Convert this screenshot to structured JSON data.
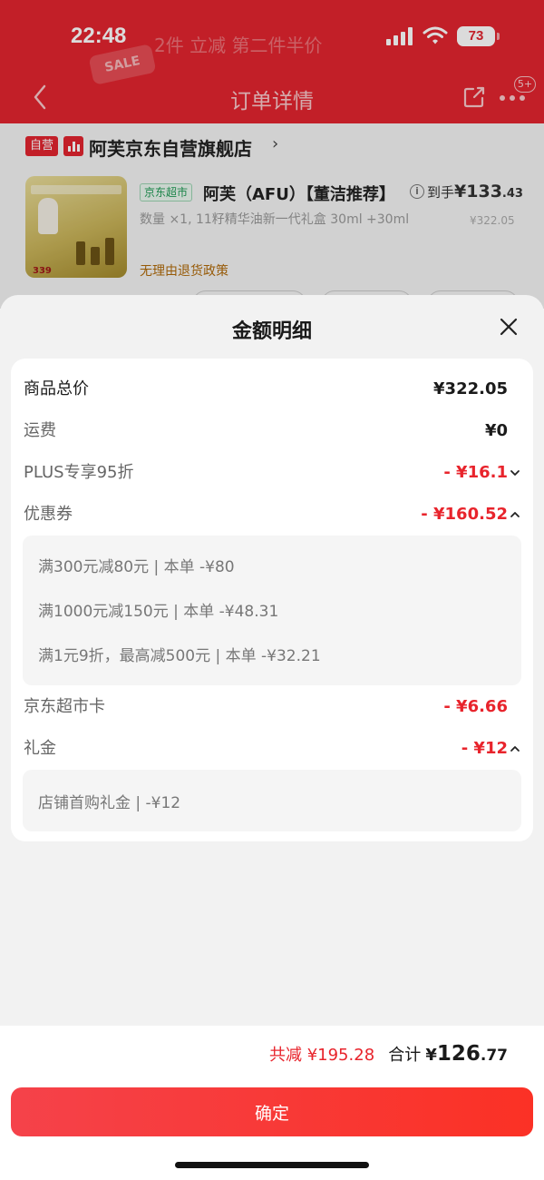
{
  "status_bar": {
    "time": "22:48",
    "battery": "73"
  },
  "background": {
    "deco_text": "2件 立减 第二件半价",
    "deco_badge": "SALE",
    "nav": {
      "title": "订单详情",
      "badge": "5+"
    },
    "store": {
      "tag": "自营",
      "name": "阿芙京东自营旗舰店",
      "arrow": "›"
    },
    "product": {
      "image_price": "339",
      "channel_tag": "京东超市",
      "title": "阿芙（AFU）【董洁推荐】",
      "info_icon": "i",
      "arrive_label": "到手",
      "arrive_currency": "¥",
      "arrive_int": "133",
      "arrive_dec": ".43",
      "spec": "数量 ×1, 11籽精华油新一代礼盒 30ml +30ml",
      "original_price": "¥322.05",
      "policy": "无理由退货政策"
    }
  },
  "sheet": {
    "title": "金额明细",
    "rows": {
      "total_goods": {
        "label": "商品总价",
        "value": "¥322.05"
      },
      "shipping": {
        "label": "运费",
        "value": "¥0"
      },
      "plus": {
        "label": "PLUS专享95折",
        "value": "- ¥16.1"
      },
      "coupon": {
        "label": "优惠券",
        "value": "- ¥160.52"
      },
      "supermarket_card": {
        "label": "京东超市卡",
        "value": "- ¥6.66"
      },
      "gift": {
        "label": "礼金",
        "value": "- ¥12"
      }
    },
    "coupon_items": [
      "满300元减80元 | 本单 -¥80",
      "满1000元减150元 | 本单 -¥48.31",
      "满1元9折，最高减500元 | 本单 -¥32.21"
    ],
    "gift_items": [
      "店铺首购礼金 | -¥12"
    ]
  },
  "footer": {
    "saved": "共减 ¥195.28",
    "total_label": "合计",
    "total_currency": "¥",
    "total_int": "126",
    "total_dec": ".77",
    "confirm": "确定"
  },
  "colors": {
    "accent_red": "#e8242c",
    "header_red": "#e2252f",
    "jd_green": "#1f9a55"
  },
  "icons": [
    "back-icon",
    "share-icon",
    "more-icon",
    "info-icon",
    "close-icon",
    "chevron-down-icon",
    "chevron-up-icon",
    "signal-icon",
    "wifi-icon",
    "store-chart-icon"
  ]
}
